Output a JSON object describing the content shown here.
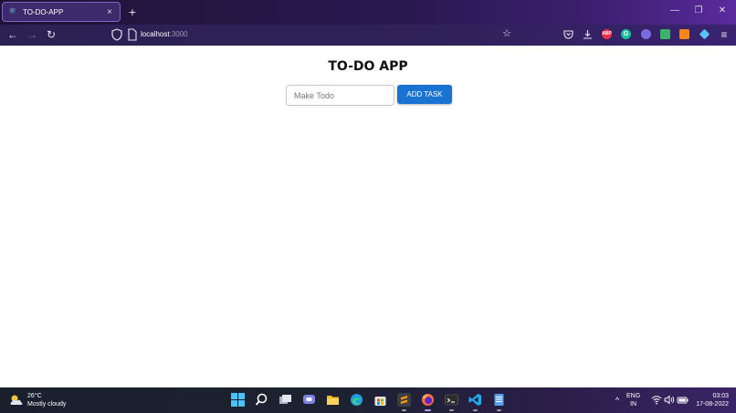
{
  "browser": {
    "tab": {
      "title": "TO-DO-APP",
      "close": "×",
      "favicon": "react-icon"
    },
    "new_tab": "+",
    "window_controls": {
      "minimize": "—",
      "restore": "❐",
      "close": "✕"
    },
    "nav": {
      "back": "←",
      "forward": "→",
      "reload": "↻"
    },
    "url": {
      "host": "localhost",
      "port": ":3000"
    },
    "bookmark": "☆",
    "extensions": [
      {
        "name": "pocket-icon",
        "color": "#e8e6f0",
        "label": ""
      },
      {
        "name": "download-icon",
        "color": "#e8e6f0",
        "label": ""
      },
      {
        "name": "adblock-icon",
        "color": "#e8314a",
        "label": "ABP"
      },
      {
        "name": "grammarly-icon",
        "color": "#15c39a",
        "label": "G"
      },
      {
        "name": "chat-icon",
        "color": "#7b6be0",
        "label": ""
      },
      {
        "name": "extension-green-icon",
        "color": "#3bb36a",
        "label": ""
      },
      {
        "name": "metamask-icon",
        "color": "#f6851b",
        "label": ""
      },
      {
        "name": "gem-icon",
        "color": "#56c3f0",
        "label": ""
      }
    ],
    "menu": "≡"
  },
  "app": {
    "title": "TO-DO APP",
    "input": {
      "placeholder": "Make Todo",
      "value": ""
    },
    "add_button": "ADD TASK"
  },
  "taskbar": {
    "weather": {
      "temp": "26°C",
      "condition": "Mostly cloudy"
    },
    "tray": {
      "chevron": "^",
      "lang_top": "ENG",
      "lang_bottom": "IN",
      "time": "03:03",
      "date": "17-08-2022"
    }
  }
}
